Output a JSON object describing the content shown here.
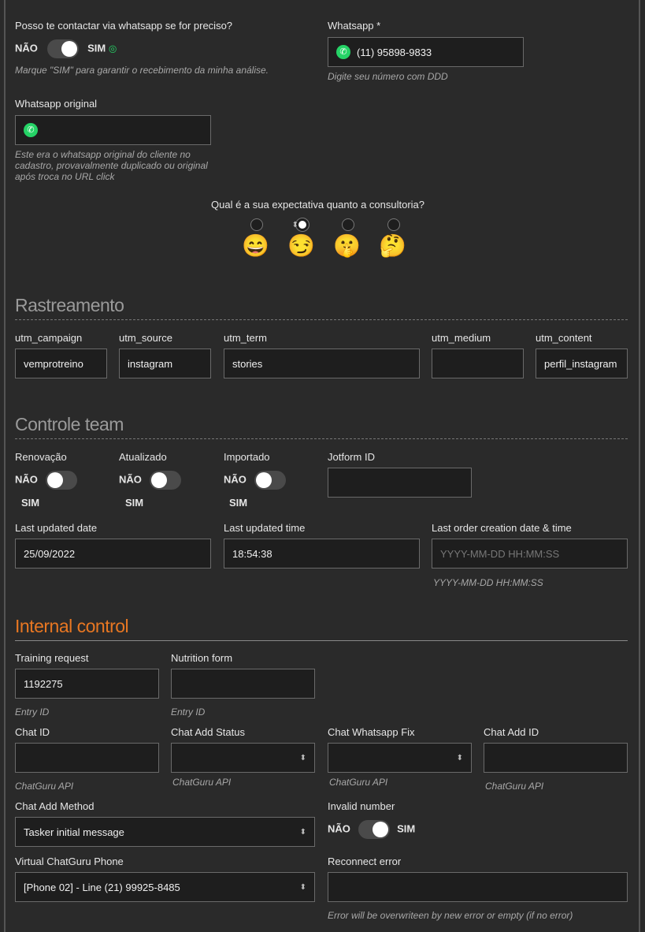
{
  "contact": {
    "question": "Posso te contactar via whatsapp se for preciso?",
    "no": "NÃO",
    "yes": "SIM",
    "on": true,
    "help": "Marque \"SIM\" para garantir o recebimento da minha análise."
  },
  "whatsapp": {
    "label": "Whatsapp *",
    "value": "(11) 95898-9833",
    "help": "Digite seu número com DDD"
  },
  "whatsapp_original": {
    "label": "Whatsapp original",
    "value": "",
    "help": "Este era o whatsapp original do cliente no cadastro, provavalmente duplicado ou original após troca no URL click"
  },
  "expectation": {
    "question": "Qual é a sua expectativa quanto a consultoria?",
    "options": [
      "😄",
      "😏",
      "🤫",
      "🤔"
    ],
    "selected": 1
  },
  "tracking": {
    "title": "Rastreamento",
    "fields": [
      {
        "label": "utm_campaign",
        "value": "vemprotreino"
      },
      {
        "label": "utm_source",
        "value": "instagram"
      },
      {
        "label": "utm_term",
        "value": "stories"
      },
      {
        "label": "utm_medium",
        "value": ""
      },
      {
        "label": "utm_content",
        "value": "perfil_instagram"
      }
    ]
  },
  "team": {
    "title": "Controle team",
    "toggles": [
      {
        "label": "Renovação",
        "no": "NÃO",
        "yes": "SIM"
      },
      {
        "label": "Atualizado",
        "no": "NÃO",
        "yes": "SIM"
      },
      {
        "label": "Importado",
        "no": "NÃO",
        "yes": "SIM"
      }
    ],
    "jotform": {
      "label": "Jotform ID",
      "value": ""
    },
    "last_date": {
      "label": "Last updated date",
      "value": "25/09/2022"
    },
    "last_time": {
      "label": "Last updated time",
      "value": "18:54:38"
    },
    "last_order": {
      "label": "Last order creation date & time",
      "placeholder": "YYYY-MM-DD HH:MM:SS",
      "help": "YYYY-MM-DD HH:MM:SS"
    }
  },
  "internal": {
    "title": "Internal control",
    "training": {
      "label": "Training request",
      "value": "1192275",
      "help": "Entry ID"
    },
    "nutrition": {
      "label": "Nutrition form",
      "value": "",
      "help": "Entry ID"
    },
    "chat_id": {
      "label": "Chat ID",
      "value": "",
      "help": "ChatGuru API"
    },
    "chat_add_status": {
      "label": "Chat Add Status",
      "value": "",
      "help": "ChatGuru API"
    },
    "chat_wa_fix": {
      "label": "Chat Whatsapp Fix",
      "value": "",
      "help": "ChatGuru API"
    },
    "chat_add_id": {
      "label": "Chat Add ID",
      "value": "",
      "help": "ChatGuru API"
    },
    "chat_add_method": {
      "label": "Chat Add Method",
      "value": "Tasker initial message"
    },
    "invalid": {
      "label": "Invalid number",
      "no": "NÃO",
      "yes": "SIM"
    },
    "virtual_phone": {
      "label": "Virtual ChatGuru Phone",
      "value": "[Phone 02] - Line (21) 99925-8485"
    },
    "reconnect": {
      "label": "Reconnect error",
      "value": "",
      "help": "Error will be overwriteen by new error or empty (if no error)"
    }
  },
  "colors": {
    "accent": "#e87722",
    "whatsapp": "#25d366"
  }
}
